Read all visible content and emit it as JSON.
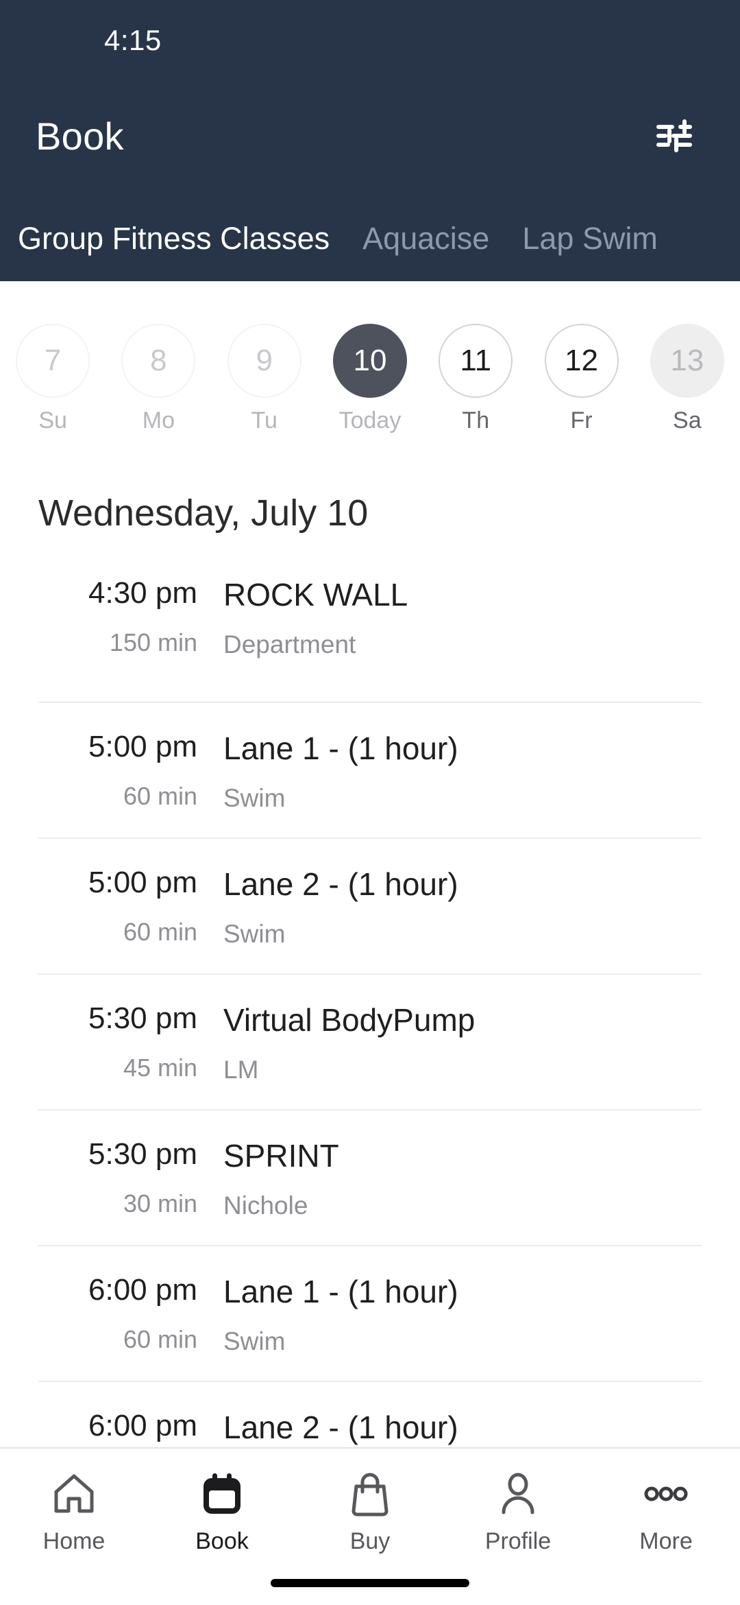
{
  "status_bar": {
    "time": "4:15"
  },
  "header": {
    "title": "Book",
    "filter_icon": "tune-filter-icon",
    "background_color": "#283549",
    "tabs": [
      {
        "label": "Group Fitness Classes",
        "active": true
      },
      {
        "label": "Aquacise",
        "active": false
      },
      {
        "label": "Lap Swim",
        "active": false
      }
    ]
  },
  "date_strip": {
    "days": [
      {
        "number": "7",
        "label": "Su",
        "state": "disabled"
      },
      {
        "number": "8",
        "label": "Mo",
        "state": "disabled"
      },
      {
        "number": "9",
        "label": "Tu",
        "state": "disabled"
      },
      {
        "number": "10",
        "label": "Today",
        "state": "selected"
      },
      {
        "number": "11",
        "label": "Th",
        "state": "normal"
      },
      {
        "number": "12",
        "label": "Fr",
        "state": "normal"
      },
      {
        "number": "13",
        "label": "Sa",
        "state": "pressed"
      }
    ],
    "selected_color": "#4e525c"
  },
  "schedule": {
    "date_heading": "Wednesday, July 10",
    "items": [
      {
        "time": "4:30 pm",
        "duration": "150 min",
        "title": "ROCK WALL",
        "subtitle": "Department"
      },
      {
        "time": "5:00 pm",
        "duration": "60 min",
        "title": "Lane 1 - (1 hour)",
        "subtitle": "Swim"
      },
      {
        "time": "5:00 pm",
        "duration": "60 min",
        "title": "Lane 2 - (1 hour)",
        "subtitle": "Swim"
      },
      {
        "time": "5:30 pm",
        "duration": "45 min",
        "title": "Virtual BodyPump",
        "subtitle": "LM"
      },
      {
        "time": "5:30 pm",
        "duration": "30 min",
        "title": "SPRINT",
        "subtitle": "Nichole"
      },
      {
        "time": "6:00 pm",
        "duration": "60 min",
        "title": "Lane 1 - (1 hour)",
        "subtitle": "Swim"
      },
      {
        "time": "6:00 pm",
        "duration": "",
        "title": "Lane 2 - (1 hour)",
        "subtitle": ""
      }
    ]
  },
  "bottom_nav": {
    "items": [
      {
        "label": "Home",
        "icon": "home-icon",
        "active": false
      },
      {
        "label": "Book",
        "icon": "calendar-icon",
        "active": true
      },
      {
        "label": "Buy",
        "icon": "bag-icon",
        "active": false
      },
      {
        "label": "Profile",
        "icon": "person-icon",
        "active": false
      },
      {
        "label": "More",
        "icon": "ellipsis-icon",
        "active": false
      }
    ]
  }
}
